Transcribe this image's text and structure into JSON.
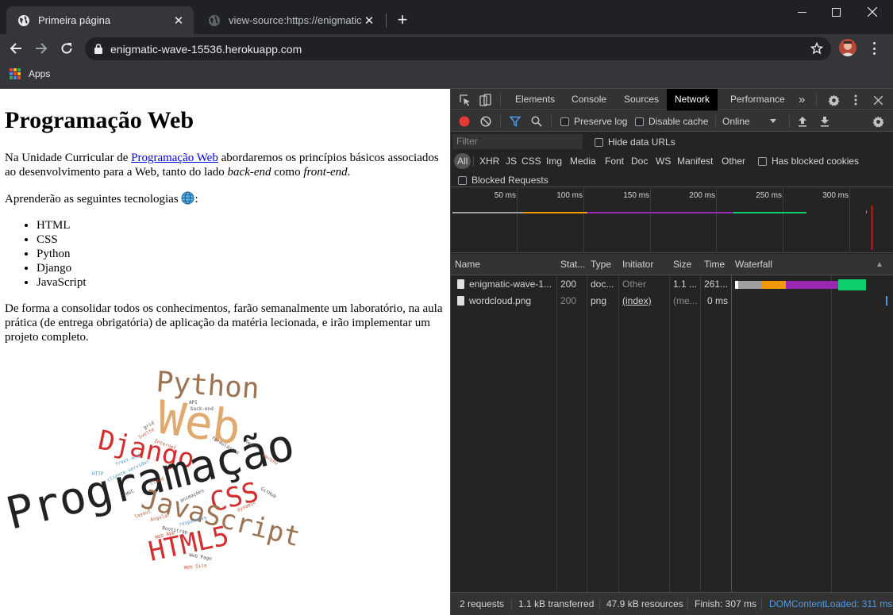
{
  "browser": {
    "tabs": [
      {
        "title": "Primeira página",
        "active": true
      },
      {
        "title": "view-source:https://enigmatic-wa",
        "active": false
      }
    ],
    "url": "enigmatic-wave-15536.herokuapp.com",
    "bookmarks": {
      "apps_label": "Apps"
    }
  },
  "page": {
    "heading": "Programação Web",
    "intro": {
      "before": "Na Unidade Curricular de ",
      "link": "Programação Web",
      "middle": " abordaremos os princípios básicos associados ao desenvolvimento para a Web, tanto do lado ",
      "em1": "back-end",
      "and": " como ",
      "em2": "front-end",
      "end": "."
    },
    "tech_intro": "Aprenderão as seguintes tecnologias",
    "tech_suffix": ":",
    "technologies": [
      "HTML",
      "CSS",
      "Python",
      "Django",
      "JavaScript"
    ],
    "closing": "De forma a consolidar todos os conhecimentos, farão semanalmente um laboratório, na aula prática (de entrega obrigatória) de aplicação da matéria lecionada, e irão implementar um projeto completo.",
    "wordcloud": {
      "big": [
        "Python",
        "Web",
        "Django",
        "Programação",
        "CSS",
        "JavaScript",
        "HTML5"
      ],
      "small": [
        "API",
        "back-end",
        "grid",
        "Svelte",
        "Internet",
        "React",
        "formulários",
        "front-end",
        "cliente-servidor",
        "Heroku",
        "HTTP",
        "Cloud",
        "MVC",
        "animações",
        "GitHub",
        "dynamic",
        "layout",
        "Angular",
        "Bootstrap",
        "responsive",
        "Web App",
        "Web Page",
        "Web Site"
      ]
    }
  },
  "devtools": {
    "tabs": [
      "Elements",
      "Console",
      "Sources",
      "Network",
      "Performance"
    ],
    "active_tab": "Network",
    "more_tabs": "»",
    "toolbar": {
      "preserve_log": "Preserve log",
      "disable_cache": "Disable cache",
      "throttling": "Online"
    },
    "filter": {
      "placeholder": "Filter",
      "hide_data_urls": "Hide data URLs",
      "types": [
        "All",
        "XHR",
        "JS",
        "CSS",
        "Img",
        "Media",
        "Font",
        "Doc",
        "WS",
        "Manifest",
        "Other"
      ],
      "selected_type": "All",
      "has_blocked_cookies": "Has blocked cookies",
      "blocked_requests": "Blocked Requests"
    },
    "overview": {
      "ticks": [
        "50 ms",
        "100 ms",
        "150 ms",
        "200 ms",
        "250 ms",
        "300 ms"
      ]
    },
    "table": {
      "columns": [
        "Name",
        "Stat...",
        "Type",
        "Initiator",
        "Size",
        "Time",
        "Waterfall"
      ],
      "sort_indicator": "▲",
      "rows": [
        {
          "name": "enigmatic-wave-1...",
          "status": "200",
          "type": "doc...",
          "initiator": "Other",
          "size": "1.1 ...",
          "time": "261..."
        },
        {
          "name": "wordcloud.png",
          "status": "200",
          "type": "png",
          "initiator": "(index)",
          "size": "(me...",
          "time": "0 ms"
        }
      ]
    },
    "status": {
      "requests": "2 requests",
      "transferred": "1.1 kB transferred",
      "resources": "47.9 kB resources",
      "finish": "Finish: 307 ms",
      "dom_content_loaded": "DOMContentLoaded: 311 ms"
    },
    "colors": {
      "waiting": "#9e9e9e",
      "dns": "#f29900",
      "ttfb": "#9c27b0",
      "download": "#0cce6b",
      "record": "#e53935",
      "filter_active": "#4e9be8"
    }
  }
}
